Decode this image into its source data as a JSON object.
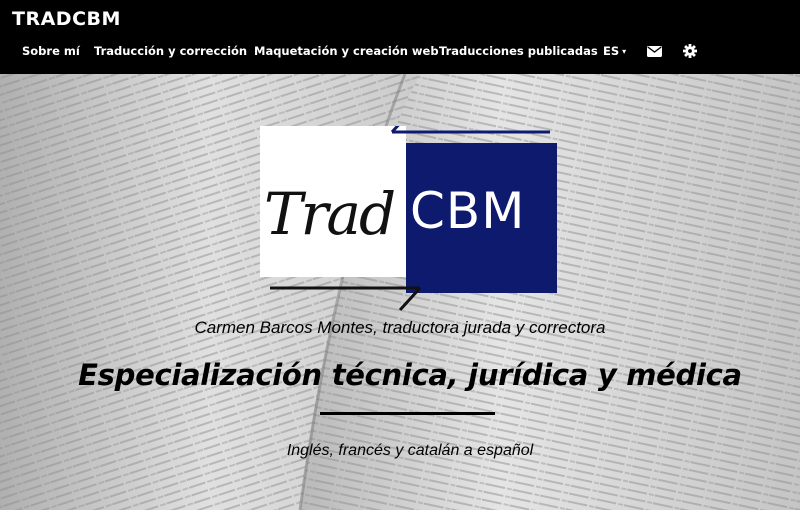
{
  "brand": "TRADCBM",
  "nav": {
    "items": [
      "Sobre mí",
      "Traducción y corrección",
      "Maquetación y creación web",
      "Traducciones publicadas"
    ],
    "language": "ES",
    "language_caret": "▾",
    "icons": [
      "envelope-icon",
      "gear-icon"
    ]
  },
  "hero": {
    "logo_left": "Trad",
    "logo_right": "CBM",
    "subtitle": "Carmen Barcos Montes, traductora jurada y correctora",
    "headline": "Especialización técnica, jurídica y médica",
    "languages": "Inglés, francés y catalán a español"
  },
  "colors": {
    "topbar": "#000000",
    "logo_blue": "#0d1a6e"
  }
}
